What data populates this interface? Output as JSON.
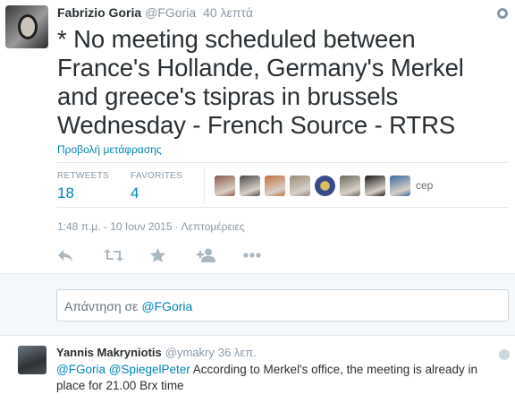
{
  "tweet": {
    "author_name": "Fabrizio Goria",
    "author_handle": "@FGoria",
    "time_ago": "40 λεπτά",
    "text": "* No meeting scheduled between France's Hollande, Germany's Merkel and greece's tsipras in brussels Wednesday - French Source - RTRS",
    "translate_link": "Προβολή μετάφρασης",
    "stats": {
      "retweets_label": "RETWEETS",
      "retweets_value": "18",
      "favorites_label": "FAVORITES",
      "favorites_value": "4"
    },
    "favoriters": [
      {
        "name": "user-avatar",
        "color": "#8a5a4a"
      },
      {
        "name": "user-avatar",
        "color": "#4a4a4a"
      },
      {
        "name": "user-avatar",
        "color": "#c07040"
      },
      {
        "name": "user-avatar",
        "color": "#9a8a7a"
      },
      {
        "name": "fbi-seal",
        "color": "#3a4a8a"
      },
      {
        "name": "user-avatar",
        "color": "#6a6a5a"
      },
      {
        "name": "user-avatar",
        "color": "#1a1a1a"
      },
      {
        "name": "user-avatar",
        "color": "#3a6aa0"
      }
    ],
    "favoriter_cep_text": "cep",
    "timestamp": "1:48 π.μ. - 10 Ιουν 2015",
    "details_link": "Λεπτομέρειες"
  },
  "reply_box": {
    "prefix": "Απάντηση σε",
    "mention": "@FGoria"
  },
  "reply_tweet": {
    "author_name": "Yannis Makryniotis",
    "author_handle": "@ymakry",
    "time_ago": "36 λεπ.",
    "mention1": "@FGoria",
    "mention2": "@SpiegelPeter",
    "text": "According to Merkel's office, the meeting is already in place for 21.00 Brx time"
  },
  "colors": {
    "link": "#0084b4",
    "muted": "#8899a6",
    "text": "#292f33",
    "border": "#e1e8ed"
  }
}
